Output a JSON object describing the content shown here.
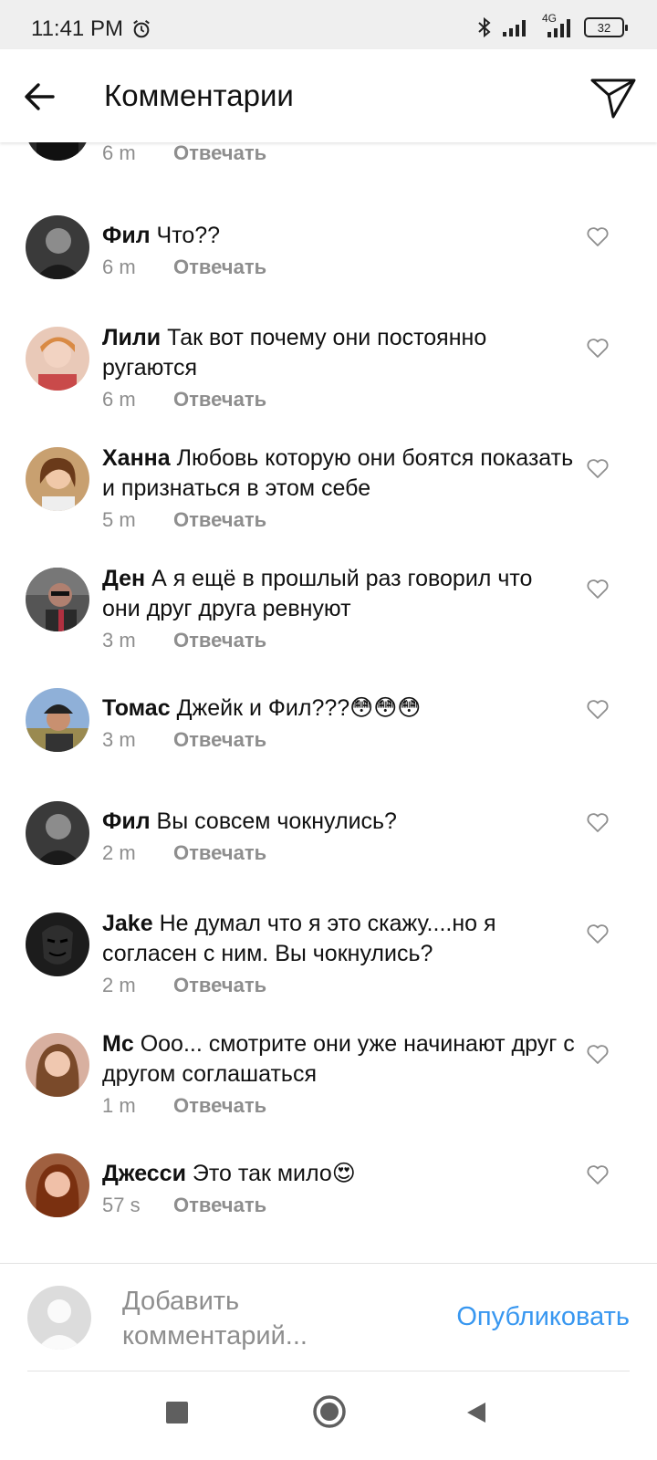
{
  "status_bar": {
    "time": "11:41 PM",
    "network": "4G",
    "battery": "32"
  },
  "header": {
    "title": "Комментарии"
  },
  "reply_label": "Отвечать",
  "comments": [
    {
      "author": "",
      "text": "",
      "time": "6 m"
    },
    {
      "author": "Фил",
      "text": "Что??",
      "time": "6 m"
    },
    {
      "author": "Лили",
      "text": "Так вот почему они постоянно ругаются",
      "time": "6 m"
    },
    {
      "author": "Ханна",
      "text": "Любовь которую они боятся показать и признаться в этом себе",
      "time": "5 m"
    },
    {
      "author": "Ден",
      "text": "А я ещё в прошлый раз говорил что они друг друга ревнуют",
      "time": "3 m"
    },
    {
      "author": "Томас",
      "text": "Джейк и Фил???😳😳😳",
      "time": "3 m"
    },
    {
      "author": "Фил",
      "text": "Вы совсем чокнулись?",
      "time": "2 m"
    },
    {
      "author": "Jake",
      "text": "Не думал что я это скажу....но я согласен с ним. Вы чокнулись?",
      "time": "2 m"
    },
    {
      "author": "Mc",
      "text": "Ооо... смотрите они уже начинают друг с другом соглашаться",
      "time": "1 m"
    },
    {
      "author": "Джесси",
      "text": "Это так мило😍",
      "time": "57 s"
    }
  ],
  "composer": {
    "placeholder": "Добавить комментарий...",
    "publish_label": "Опубликовать"
  },
  "colors": {
    "accent": "#3897f0",
    "muted_text": "#8e8e8e",
    "status_bar_bg": "#efefef"
  },
  "icons": {
    "back": "arrow-left-icon",
    "direct": "paper-plane-icon",
    "like": "heart-outline-icon",
    "nav_recents": "square-icon",
    "nav_home": "circle-icon",
    "nav_back": "triangle-left-icon"
  }
}
